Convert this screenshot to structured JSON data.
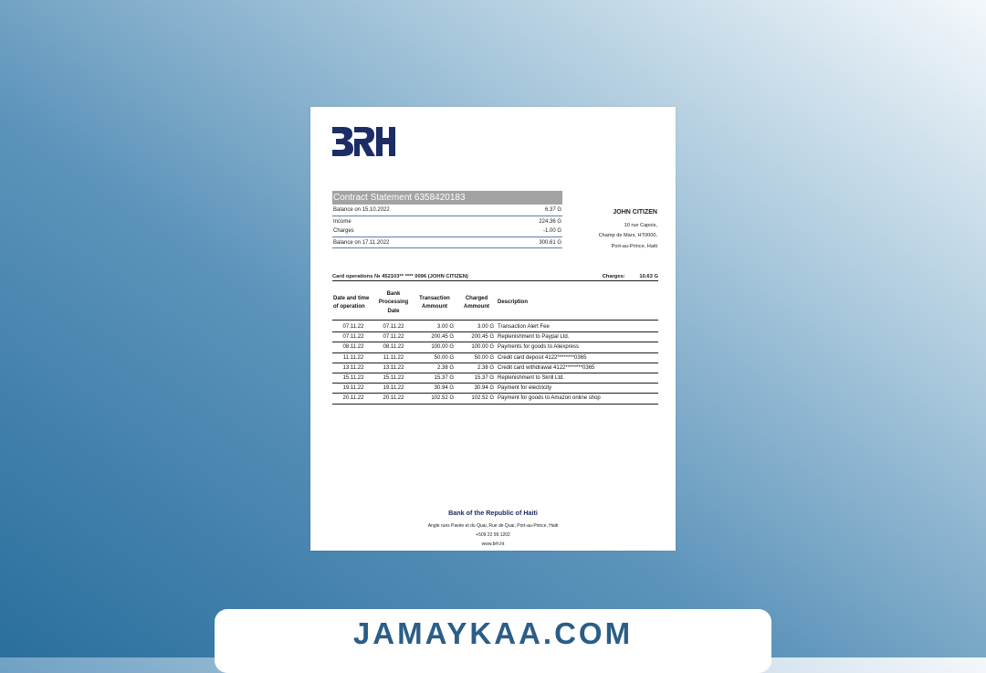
{
  "document": {
    "logo_text": "BRH",
    "statement_title": "Contract Statement 6358420183",
    "summary": [
      {
        "label": "Balance on 15.10.2022",
        "value": "6.37 G"
      },
      {
        "label": "Income",
        "value": "224.36 G"
      },
      {
        "label": "Charges",
        "value": "-1.00 G"
      },
      {
        "label": "Balance on 17.11.2022",
        "value": "300.61 G"
      }
    ],
    "address": {
      "name": "JOHN CITIZEN",
      "line1": "10 rue Capois,",
      "line2": "Champ de Mars, HT0000,",
      "line3": "Port-au-Prince, Haiti"
    },
    "card_operations": {
      "label": "Card operations № 452103** **** 0096  (JOHN CITIZEN)",
      "charges_label": "Charges:",
      "charges_value": "10.63 G"
    },
    "table": {
      "headers": [
        "Date and time of operation",
        "Bank Processing Date",
        "Transaction Ammount",
        "Charged Ammount",
        "Description"
      ],
      "rows": [
        [
          "07.11.22",
          "07.11.22",
          "3.00 G",
          "3.00 G",
          "Transaction Alert Fee"
        ],
        [
          "07.11.22",
          "07.11.22",
          "200.45 G",
          "200.45 G",
          "Replenishment to Paypal Ltd."
        ],
        [
          "08.11.22",
          "08.11.22",
          "100.00 G",
          "100.00 G",
          "Payments for goods to Aliexpress"
        ],
        [
          "11.11.22",
          "11.11.22",
          "50.00 G",
          "50.00 G",
          "Credit card deposit 4122********0365"
        ],
        [
          "13.11.22",
          "13.11.22",
          "2.38 G",
          "2.38 G",
          "Credit card withdrawal 4122********0365"
        ],
        [
          "15.11.22",
          "15.11.22",
          "15.37 G",
          "15.37 G",
          "Replenishment to Skrill Ltd."
        ],
        [
          "19.11.22",
          "19.11.22",
          "30.94 G",
          "30.94 G",
          "Payment for electricity"
        ],
        [
          "20.11.22",
          "20.11.22",
          "102.52 G",
          "102.52 G",
          "Payment for goods to Amazon online shop"
        ]
      ]
    },
    "footer": {
      "bank_name": "Bank of the Republic of Haiti",
      "address": "Angle rues Pavée et du Quai, Rue de Quai, Port-au-Prince, Haiti",
      "phone": "+509 22 99 1202",
      "website": "www.brh.ht"
    }
  },
  "banner": {
    "text": "JAMAYKAA.COM"
  },
  "colors": {
    "brand_navy": "#1c2d66",
    "title_gray": "#a3a3a3",
    "banner_text": "#2b5d86"
  }
}
